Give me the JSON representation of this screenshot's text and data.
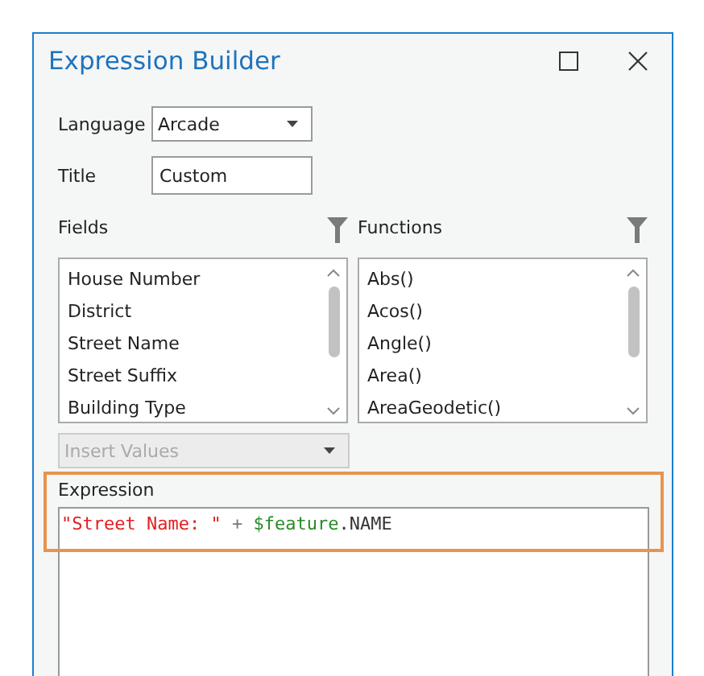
{
  "window": {
    "title": "Expression Builder"
  },
  "language": {
    "label": "Language",
    "value": "Arcade"
  },
  "title_field": {
    "label": "Title",
    "value": "Custom"
  },
  "fields": {
    "label": "Fields",
    "items": [
      "House Number",
      "District",
      "Street Name",
      "Street Suffix",
      "Building Type"
    ]
  },
  "functions": {
    "label": "Functions",
    "items": [
      "Abs()",
      "Acos()",
      "Angle()",
      "Area()",
      "AreaGeodetic()"
    ]
  },
  "insert_values": {
    "label": "Insert Values",
    "disabled": true
  },
  "expression": {
    "label": "Expression",
    "highlighted": true,
    "tokens": [
      {
        "kind": "string",
        "text": "\"Street Name: \""
      },
      {
        "kind": "operator",
        "text": " + "
      },
      {
        "kind": "variable",
        "text": "$feature"
      },
      {
        "kind": "member",
        "text": ".NAME"
      }
    ]
  }
}
